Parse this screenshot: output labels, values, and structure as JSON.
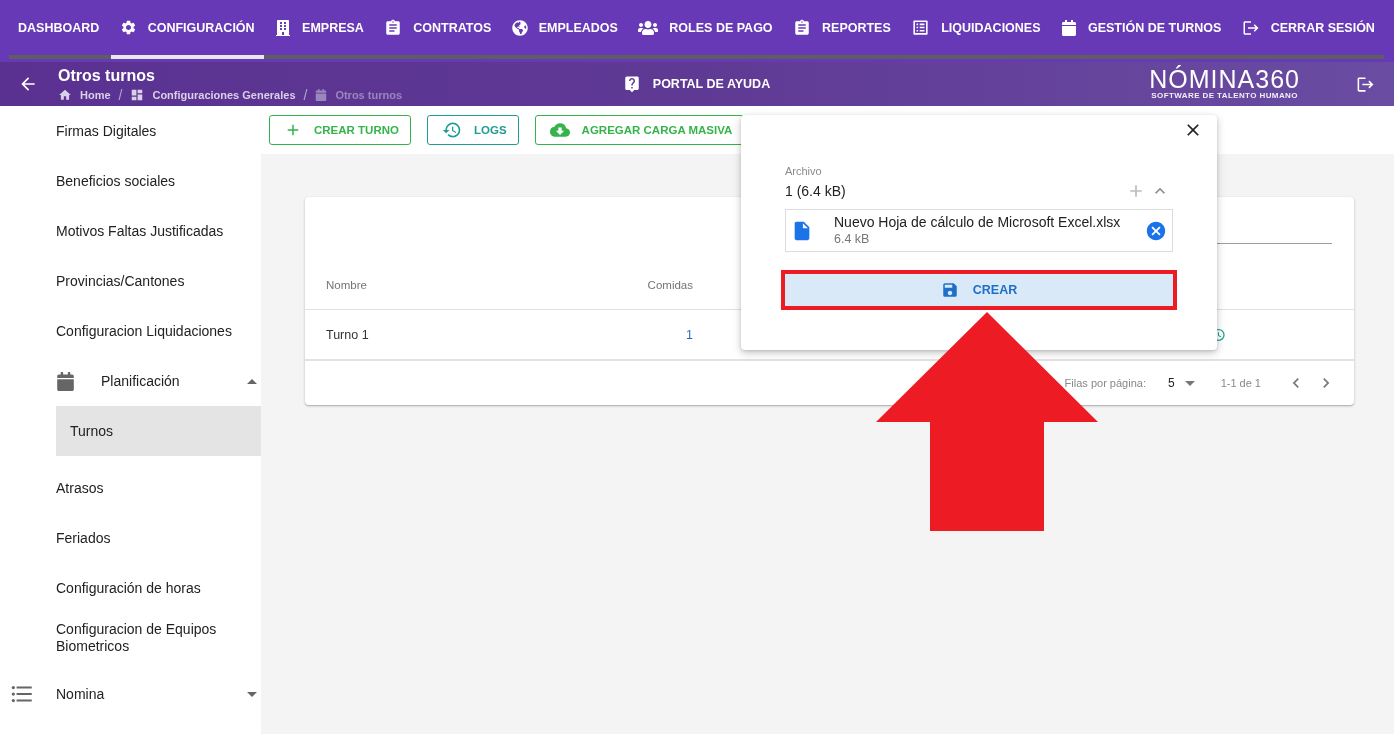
{
  "top_nav": {
    "tabs": [
      {
        "label": "DASHBOARD",
        "selected": false
      },
      {
        "label": "CONFIGURACIÓN",
        "selected": true
      },
      {
        "label": "EMPRESA",
        "selected": false
      },
      {
        "label": "CONTRATOS",
        "selected": false
      },
      {
        "label": "EMPLEADOS",
        "selected": false
      },
      {
        "label": "ROLES DE PAGO",
        "selected": false
      },
      {
        "label": "REPORTES",
        "selected": false
      },
      {
        "label": "LIQUIDACIONES",
        "selected": false
      },
      {
        "label": "GESTIÓN DE TURNOS",
        "selected": false
      },
      {
        "label": "CERRAR SESIÓN",
        "selected": false
      }
    ]
  },
  "header": {
    "title": "Otros turnos",
    "breadcrumb": [
      {
        "label": "Home",
        "current": false
      },
      {
        "separator": "/",
        "label": "Configuraciones Generales",
        "current": false
      },
      {
        "separator": "/",
        "label": "Otros turnos",
        "current": true
      }
    ],
    "help_link": "PORTAL DE AYUDA",
    "logo": {
      "name": "NÓMINA360",
      "tagline": "SOFTWARE DE TALENTO HUMANO"
    }
  },
  "sidebar": {
    "items": [
      {
        "kind": "link",
        "label": "Firmas Digitales",
        "selected": false
      },
      {
        "kind": "link",
        "label": "Beneficios sociales",
        "selected": false
      },
      {
        "kind": "link",
        "label": "Motivos Faltas Justificadas",
        "selected": false
      },
      {
        "kind": "link",
        "label": "Provincias/Cantones",
        "selected": false
      },
      {
        "kind": "link",
        "label": "Configuracion Liquidaciones",
        "selected": false
      },
      {
        "kind": "group",
        "label": "Planificación",
        "expanded": true,
        "children": [
          {
            "kind": "link",
            "label": "Turnos",
            "selected": true
          }
        ]
      },
      {
        "kind": "link",
        "label": "Atrasos",
        "selected": false
      },
      {
        "kind": "link",
        "label": "Feriados",
        "selected": false
      },
      {
        "kind": "link",
        "label": "Configuración de horas",
        "selected": false
      },
      {
        "kind": "link",
        "label": "Configuracion de Equipos Biometricos",
        "selected": false
      },
      {
        "kind": "section",
        "label": "Nomina",
        "expanded": false
      }
    ]
  },
  "toolbar": {
    "buttons": [
      {
        "label": "CREAR TURNO",
        "color": "#34b44a"
      },
      {
        "label": "LOGS",
        "color": "#1d9d93"
      },
      {
        "label": "AGREGAR CARGA MASIVA",
        "color": "#34b44a"
      }
    ]
  },
  "table": {
    "columns": [
      "Nombre",
      "Comidas"
    ],
    "rows": [
      {
        "cells": [
          "Turno 1",
          "1"
        ]
      }
    ],
    "footer": {
      "rows_per_page_label": "Filas por página:",
      "rows_per_page": "5",
      "range": "1-1 de 1"
    }
  },
  "upload_dialog": {
    "field_label": "Archivo",
    "summary": "1 (6.4 kB)",
    "files": [
      {
        "name": "Nuevo Hoja de cálculo de Microsoft Excel.xlsx",
        "size": "6.4 kB"
      }
    ],
    "submit_label": "CREAR"
  }
}
